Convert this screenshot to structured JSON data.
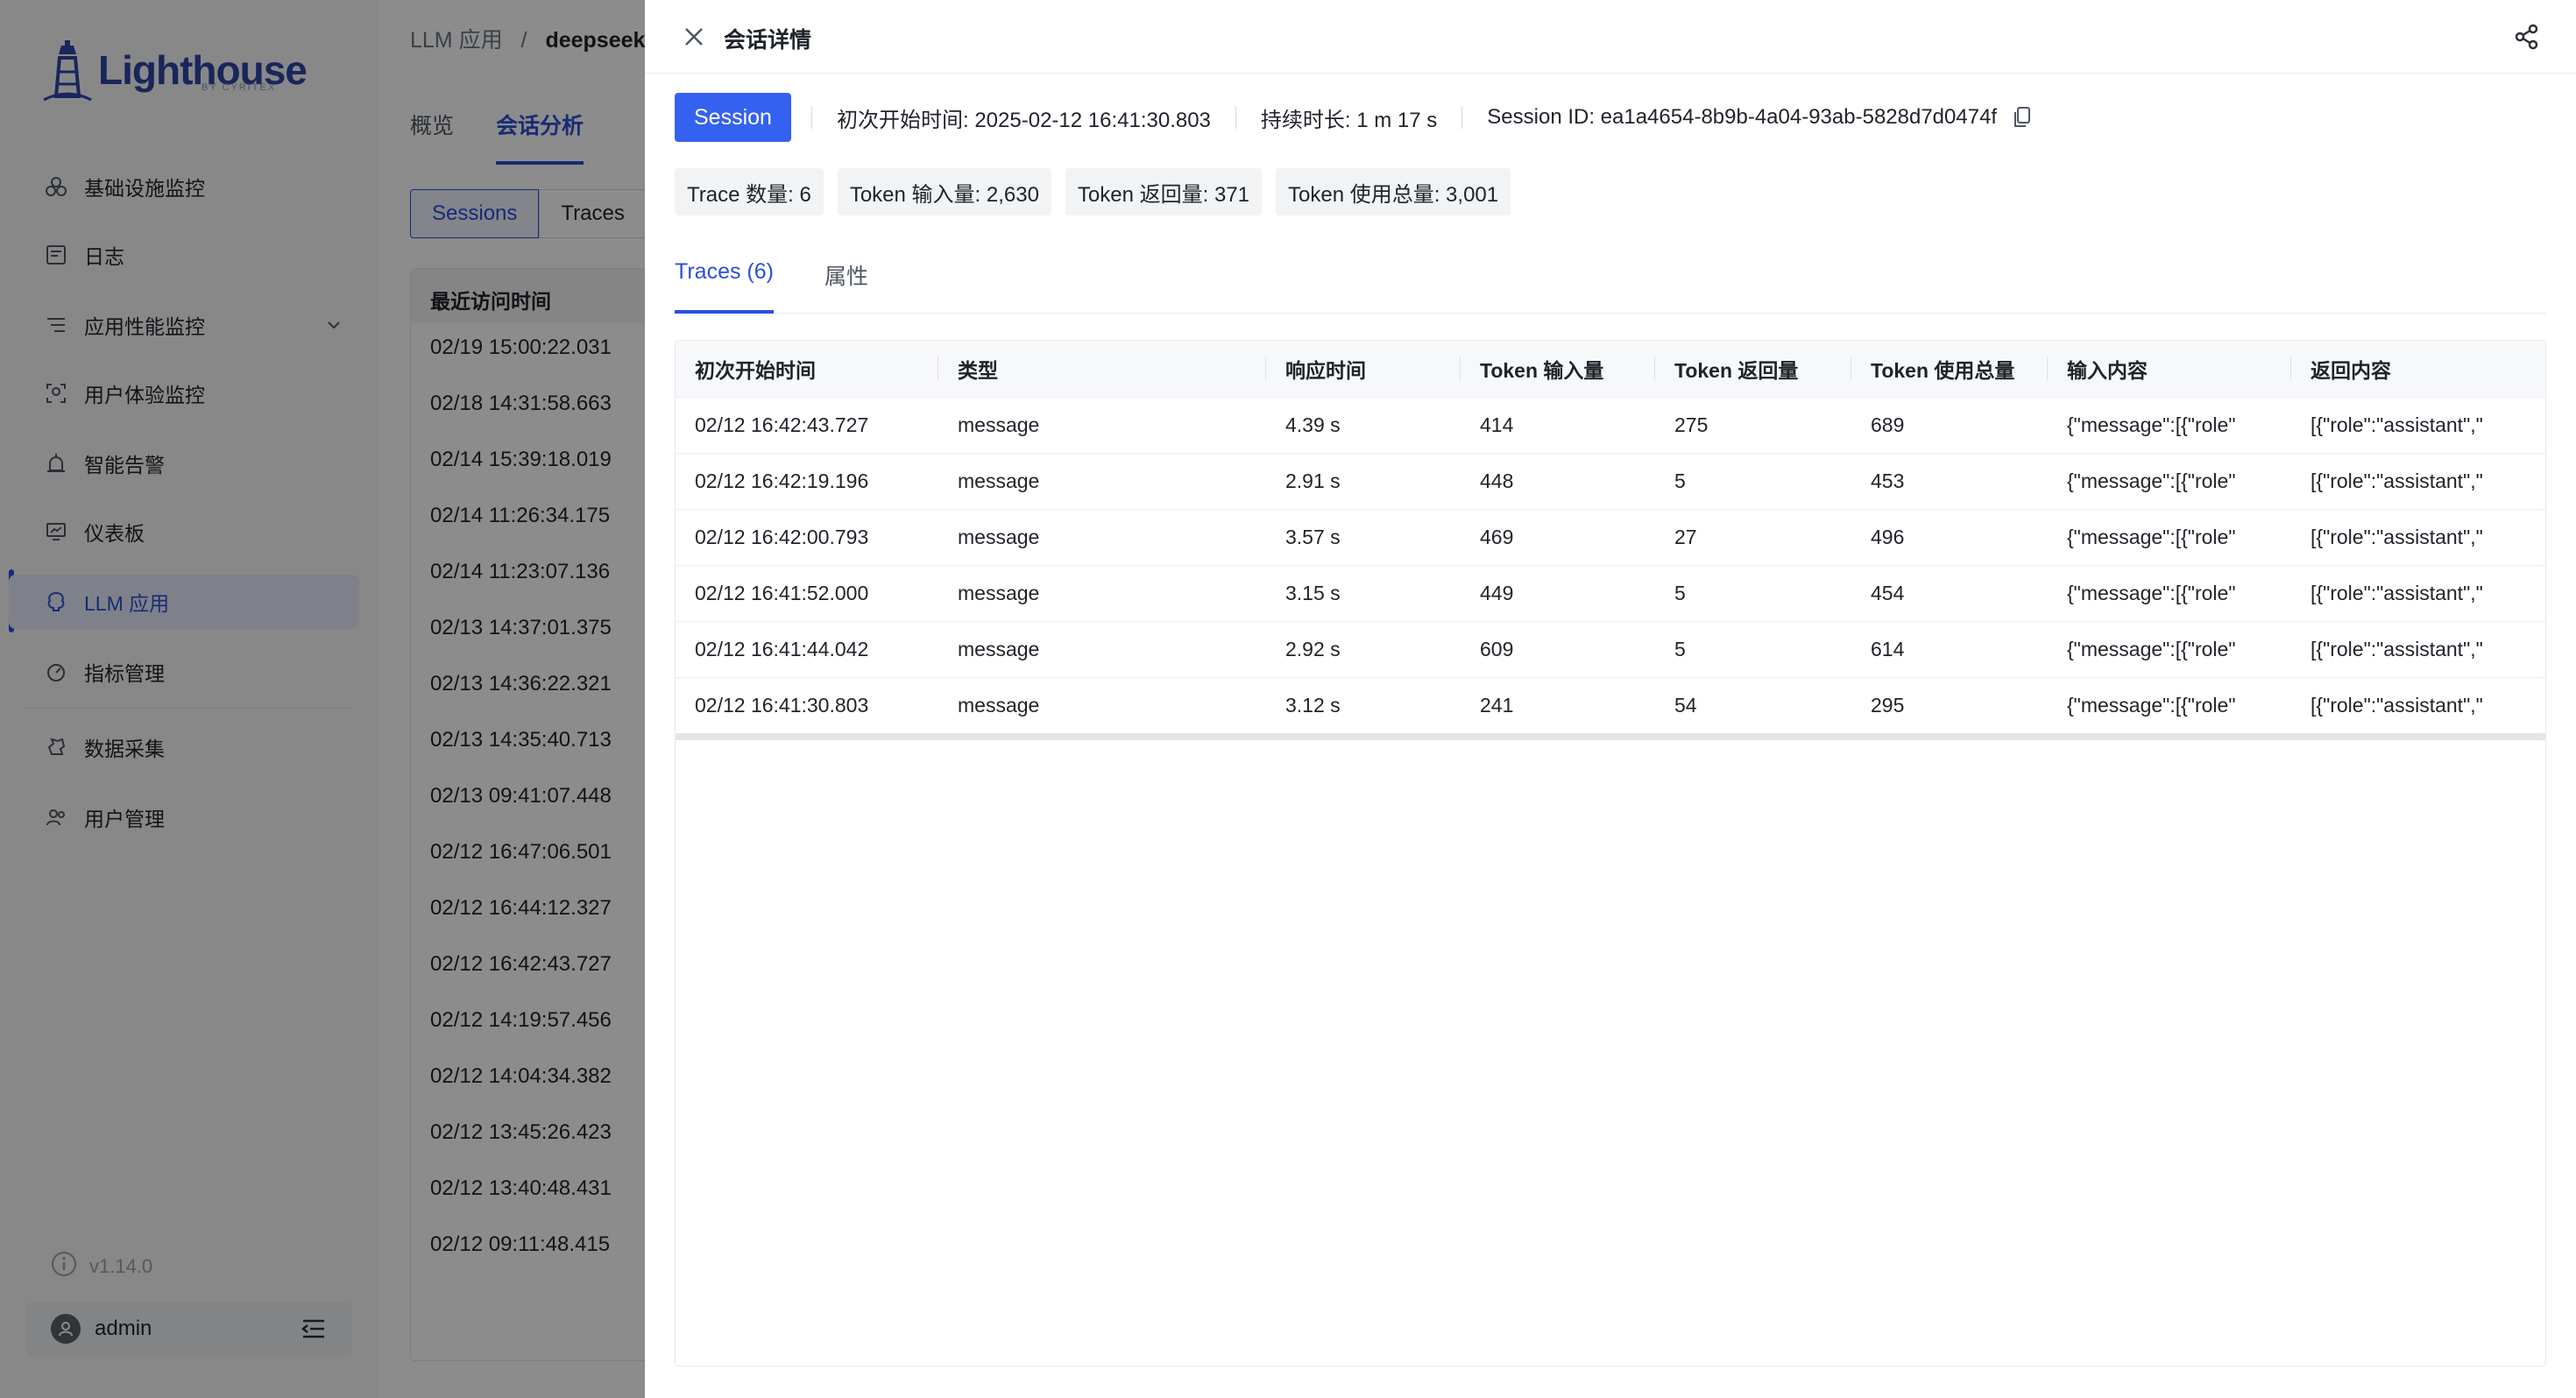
{
  "app": {
    "logo_text_a": "Light",
    "logo_text_b": "house",
    "logo_sub": "BY CYRITEX",
    "version": "v1.14.0",
    "user": "admin"
  },
  "sidebar": {
    "items": [
      {
        "label": "基础设施监控",
        "icon": "infrastructure-icon"
      },
      {
        "label": "日志",
        "icon": "log-icon"
      },
      {
        "label": "应用性能监控",
        "icon": "apm-icon"
      },
      {
        "label": "用户体验监控",
        "icon": "user-experience-icon"
      },
      {
        "label": "智能告警",
        "icon": "alarm-icon"
      },
      {
        "label": "仪表板",
        "icon": "dashboard-icon"
      },
      {
        "label": "LLM 应用",
        "icon": "llm-icon"
      },
      {
        "label": "指标管理",
        "icon": "metrics-icon"
      },
      {
        "label": "数据采集",
        "icon": "data-collection-icon"
      },
      {
        "label": "用户管理",
        "icon": "user-management-icon"
      }
    ]
  },
  "main": {
    "breadcrumb_parent": "LLM 应用",
    "breadcrumb_sep": "/",
    "breadcrumb_current": "deepseek-",
    "tabs": [
      "概览",
      "会话分析"
    ],
    "segments": [
      "Sessions",
      "Traces"
    ],
    "list_header": "最近访问时间",
    "list_rows": [
      "02/19   15:00:22.031",
      "02/18   14:31:58.663",
      "02/14   15:39:18.019",
      "02/14   11:26:34.175",
      "02/14   11:23:07.136",
      "02/13   14:37:01.375",
      "02/13   14:36:22.321",
      "02/13   14:35:40.713",
      "02/13   09:41:07.448",
      "02/12   16:47:06.501",
      "02/12   16:44:12.327",
      "02/12   16:42:43.727",
      "02/12   14:19:57.456",
      "02/12   14:04:34.382",
      "02/12   13:45:26.423",
      "02/12   13:40:48.431",
      "02/12   09:11:48.415"
    ]
  },
  "drawer": {
    "title": "会话详情",
    "session_label": "Session",
    "start_time": "初次开始时间: 2025-02-12 16:41:30.803",
    "duration": "持续时长: 1 m 17 s",
    "session_id": "Session ID: ea1a4654-8b9b-4a04-93ab-5828d7d0474f",
    "chips": [
      "Trace 数量: 6",
      "Token 输入量: 2,630",
      "Token 返回量: 371",
      "Token 使用总量: 3,001"
    ],
    "tabs": [
      "Traces (6)",
      "属性"
    ],
    "table": {
      "columns": [
        "初次开始时间",
        "类型",
        "响应时间",
        "Token 输入量",
        "Token 返回量",
        "Token 使用总量",
        "输入内容",
        "返回内容"
      ],
      "rows": [
        [
          "02/12   16:42:43.727",
          "message",
          "4.39 s",
          "414",
          "275",
          "689",
          "{\"message\":[{\"role\"",
          "[{\"role\":\"assistant\",\""
        ],
        [
          "02/12   16:42:19.196",
          "message",
          "2.91 s",
          "448",
          "5",
          "453",
          "{\"message\":[{\"role\"",
          "[{\"role\":\"assistant\",\""
        ],
        [
          "02/12   16:42:00.793",
          "message",
          "3.57 s",
          "469",
          "27",
          "496",
          "{\"message\":[{\"role\"",
          "[{\"role\":\"assistant\",\""
        ],
        [
          "02/12   16:41:52.000",
          "message",
          "3.15 s",
          "449",
          "5",
          "454",
          "{\"message\":[{\"role\"",
          "[{\"role\":\"assistant\",\""
        ],
        [
          "02/12   16:41:44.042",
          "message",
          "2.92 s",
          "609",
          "5",
          "614",
          "{\"message\":[{\"role\"",
          "[{\"role\":\"assistant\",\""
        ],
        [
          "02/12   16:41:30.803",
          "message",
          "3.12 s",
          "241",
          "54",
          "295",
          "{\"message\":[{\"role\"",
          "[{\"role\":\"assistant\",\""
        ]
      ]
    }
  },
  "colors": {
    "accent": "#3461f0",
    "overlay": "rgba(0,0,0,0.45)"
  }
}
